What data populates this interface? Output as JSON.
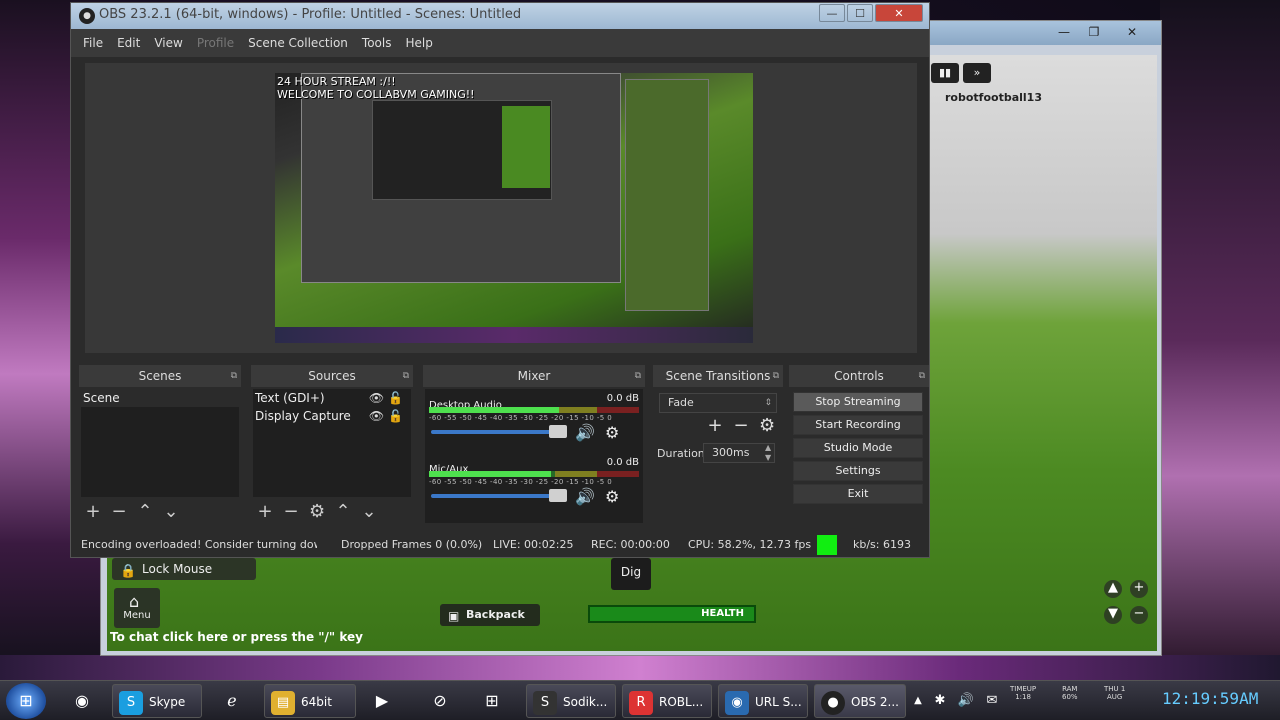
{
  "obs": {
    "title": "OBS 23.2.1 (64-bit, windows) - Profile: Untitled - Scenes: Untitled",
    "menu": [
      "File",
      "Edit",
      "View",
      "Profile",
      "Scene Collection",
      "Tools",
      "Help"
    ],
    "preview_overlay_line1": "24 HOUR STREAM :/!!",
    "preview_overlay_line2": "WELCOME TO COLLABVM GAMING!!",
    "docks": {
      "scenes": {
        "title": "Scenes",
        "items": [
          "Scene"
        ]
      },
      "sources": {
        "title": "Sources",
        "items": [
          "Text (GDI+)",
          "Display Capture"
        ]
      },
      "mixer": {
        "title": "Mixer",
        "channels": [
          {
            "name": "Desktop Audio",
            "db": "0.0 dB",
            "level": 0.62
          },
          {
            "name": "Mic/Aux",
            "db": "0.0 dB",
            "level": 0.58
          }
        ],
        "scale": "-60 -55 -50 -45 -40 -35 -30 -25 -20 -15 -10 -5 0"
      },
      "transitions": {
        "title": "Scene Transitions",
        "selected": "Fade",
        "duration_label": "Duration",
        "duration_value": "300ms"
      },
      "controls": {
        "title": "Controls",
        "buttons": [
          "Stop Streaming",
          "Start Recording",
          "Studio Mode",
          "Settings",
          "Exit"
        ]
      }
    },
    "status": {
      "encoding": "Encoding overloaded! Consider turning down",
      "dropped": "Dropped Frames 0 (0.0%)",
      "live": "LIVE: 00:02:25",
      "rec": "REC: 00:00:00",
      "cpu": "CPU: 58.2%, 12.73 fps",
      "kbs": "kb/s: 6193"
    }
  },
  "game": {
    "player_name": "robotfootball13",
    "lock_mouse": "Lock Mouse",
    "menu": "Menu",
    "dig": "Dig",
    "backpack": "Backpack",
    "health": "HEALTH",
    "chat_hint": "To chat click here or press the \"/\" key"
  },
  "taskbar": {
    "items": [
      "Skype",
      "64bit",
      "Sodik...",
      "ROBL...",
      "URL S...",
      "OBS 2..."
    ],
    "tray_time_label": "TIMEUP",
    "tray_time_value": "1:18",
    "tray_ram_label": "RAM",
    "tray_ram_value": "60%",
    "tray_day": "THU 1",
    "tray_month": "AUG",
    "clock": "12:19:59AM"
  },
  "colors": {
    "status_ok": "#11ee11",
    "accent": "#3b78c8"
  }
}
